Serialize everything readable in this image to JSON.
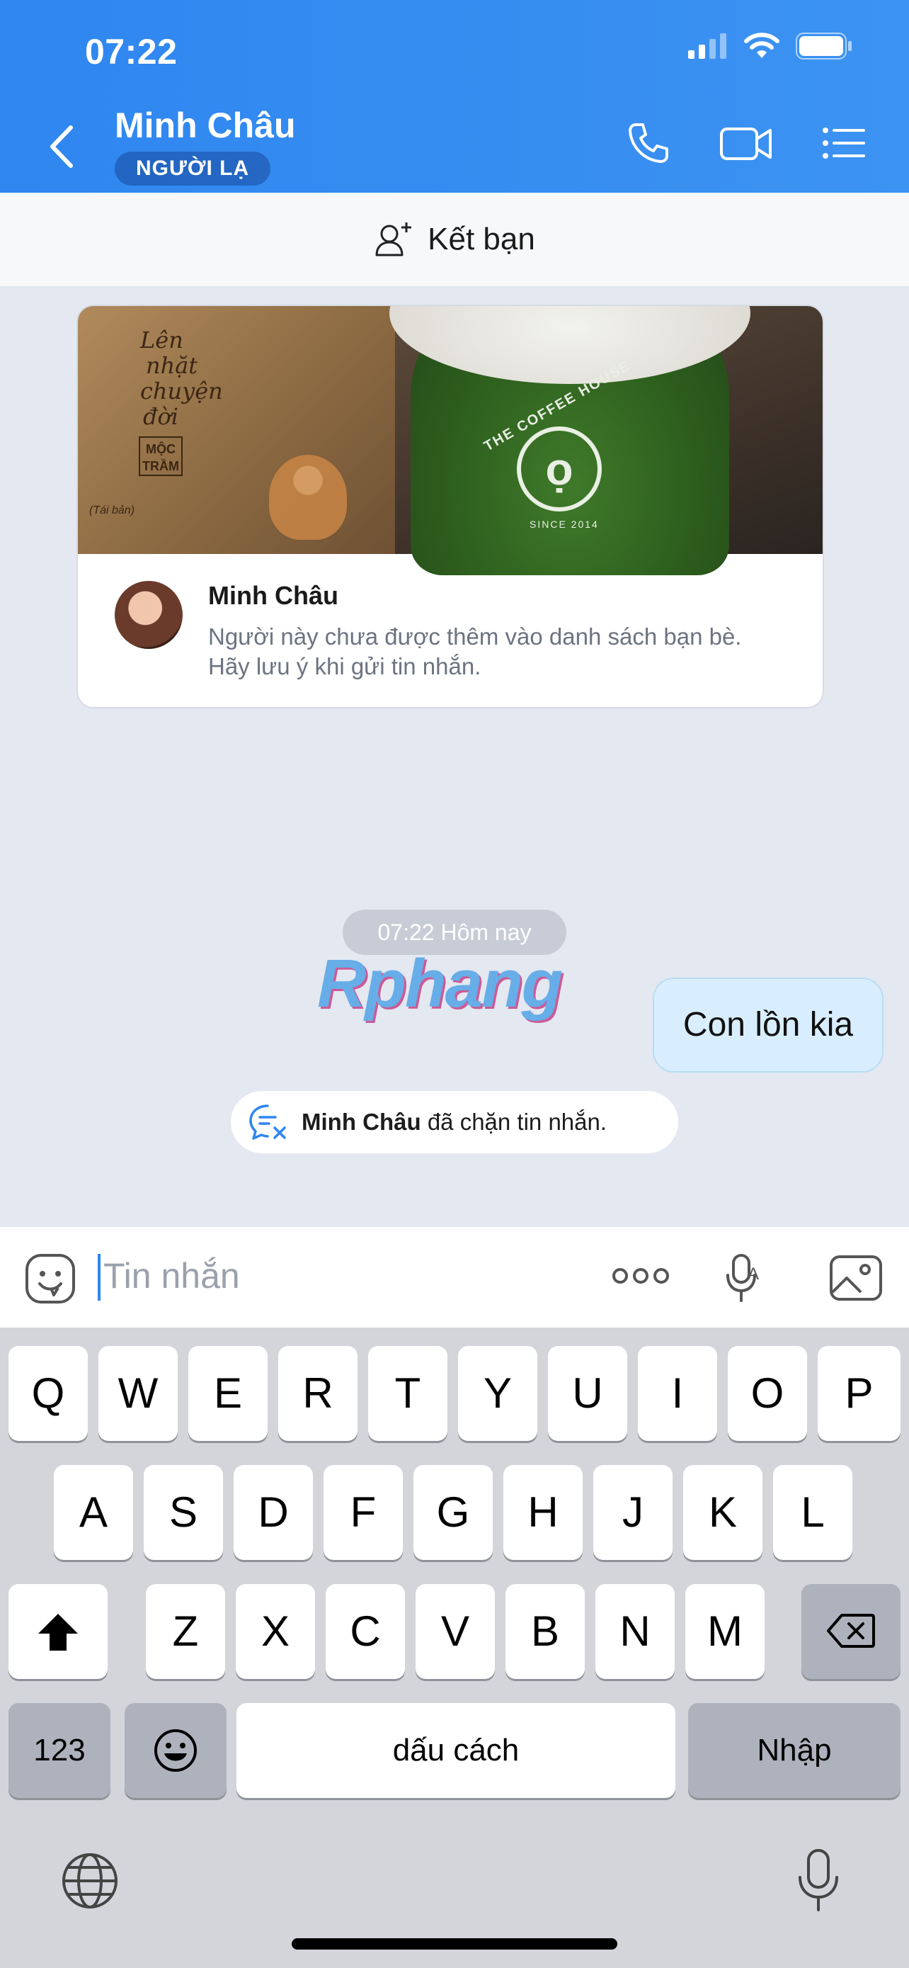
{
  "status_bar": {
    "time": "07:22"
  },
  "header": {
    "title": "Minh Châu",
    "badge": "NGƯỜI LẠ"
  },
  "add_friend": {
    "label": "Kết bạn"
  },
  "profile_card": {
    "name": "Minh Châu",
    "description": "Người này chưa được thêm vào danh sách bạn bè. Hãy lưu ý khi gửi tin nhắn.",
    "cover": {
      "book_title_lines": [
        "Lên",
        "nhặt",
        "chuyện",
        "đời"
      ],
      "book_author": "MỘC TRẦM",
      "book_edition": "(Tái bản)",
      "cup_brand": "THE COFFEE HOUSE",
      "cup_since": "SINCE 2014"
    }
  },
  "chat": {
    "timestamp": "07:22 Hôm nay",
    "watermark": "Rphang",
    "messages": [
      {
        "text": "Con lồn kia",
        "from": "me"
      }
    ],
    "blocked_name": "Minh Châu",
    "blocked_text": " đã chặn tin nhắn."
  },
  "composer": {
    "placeholder": "Tin nhắn"
  },
  "keyboard": {
    "row1": [
      "Q",
      "W",
      "E",
      "R",
      "T",
      "Y",
      "U",
      "I",
      "O",
      "P"
    ],
    "row2": [
      "A",
      "S",
      "D",
      "F",
      "G",
      "H",
      "J",
      "K",
      "L"
    ],
    "row3": [
      "Z",
      "X",
      "C",
      "V",
      "B",
      "N",
      "M"
    ],
    "numbers_label": "123",
    "space_label": "dấu cách",
    "return_label": "Nhập"
  },
  "colors": {
    "header_blue": "#2f86ef",
    "bubble": "#d8eefe",
    "keyboard_bg": "#d3d5db"
  }
}
